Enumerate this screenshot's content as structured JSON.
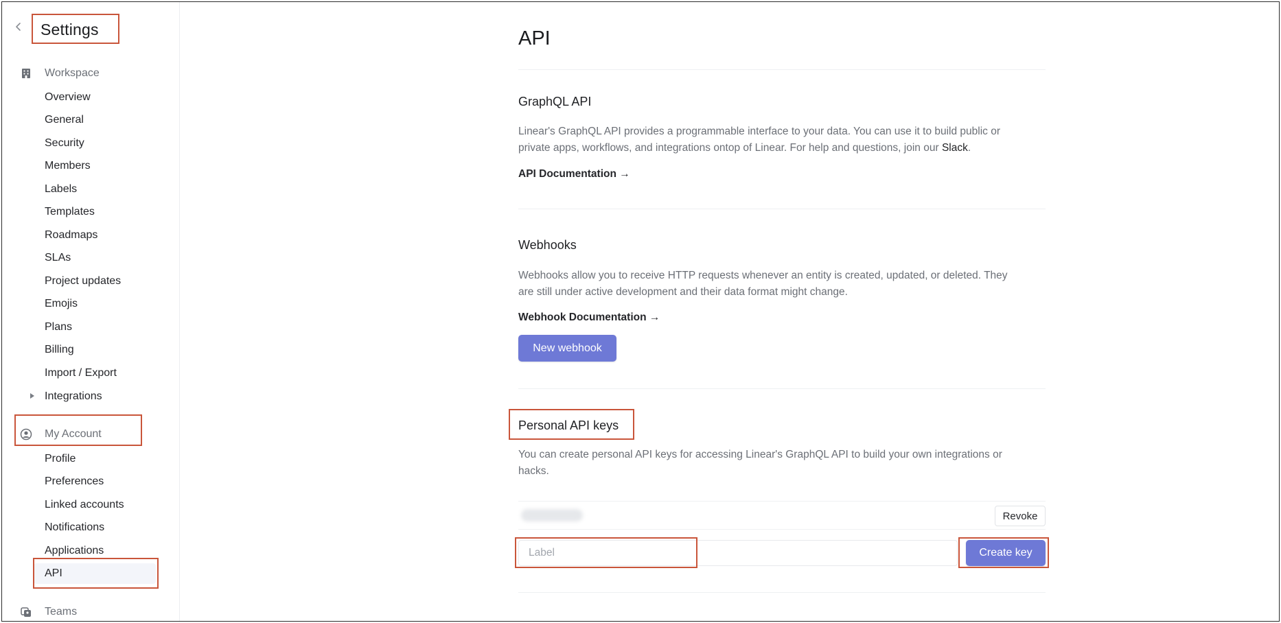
{
  "sidebar": {
    "title": "Settings",
    "workspace_header": "Workspace",
    "workspace_items": [
      "Overview",
      "General",
      "Security",
      "Members",
      "Labels",
      "Templates",
      "Roadmaps",
      "SLAs",
      "Project updates",
      "Emojis",
      "Plans",
      "Billing",
      "Import / Export",
      "Integrations"
    ],
    "account_header": "My Account",
    "account_items": [
      "Profile",
      "Preferences",
      "Linked accounts",
      "Notifications",
      "Applications",
      "API"
    ],
    "teams_header": "Teams",
    "active_item": "API"
  },
  "main": {
    "page_title": "API",
    "graphql": {
      "title": "GraphQL API",
      "desc_line1": "Linear's GraphQL API provides a programmable interface to your data. You can use it to build public or",
      "desc_line2_before": "private apps, workflows, and integrations ontop of Linear. For help and questions, join our ",
      "desc_link": "Slack",
      "desc_line2_after": ".",
      "doc_link": "API Documentation →"
    },
    "webhooks": {
      "title": "Webhooks",
      "desc_line1": "Webhooks allow you to receive HTTP requests whenever an entity is created, updated, or deleted. They",
      "desc_line2": "are still under active development and their data format might change.",
      "doc_link": "Webhook Documentation →",
      "new_button": "New webhook"
    },
    "personal_keys": {
      "title": "Personal API keys",
      "desc_line1": "You can create personal API keys for accessing Linear's GraphQL API to build your own integrations or",
      "desc_line2": "hacks.",
      "revoke_button": "Revoke",
      "label_placeholder": "Label",
      "create_button": "Create key"
    }
  },
  "colors": {
    "accent": "#6e79d6",
    "highlight": "#c9553a"
  }
}
